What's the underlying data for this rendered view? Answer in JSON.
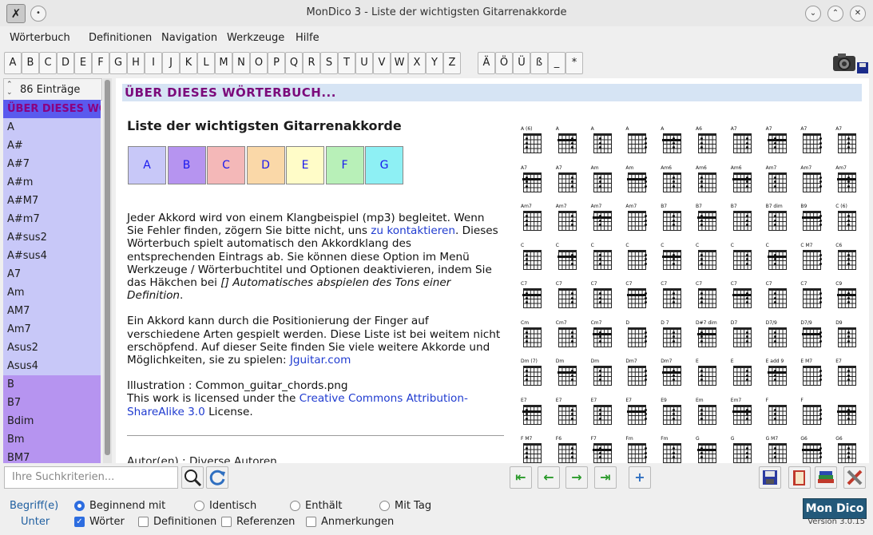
{
  "window": {
    "title": "MonDico 3 - Liste der wichtigsten Gitarrenakkorde"
  },
  "menu": [
    "Wörterbuch",
    "Definitionen",
    "Navigation",
    "Werkzeuge",
    "Hilfe"
  ],
  "letters": [
    "A",
    "B",
    "C",
    "D",
    "E",
    "F",
    "G",
    "H",
    "I",
    "J",
    "K",
    "L",
    "M",
    "N",
    "O",
    "P",
    "Q",
    "R",
    "S",
    "T",
    "U",
    "V",
    "W",
    "X",
    "Y",
    "Z",
    "Ä",
    "Ö",
    "Ü",
    "ß",
    "_",
    "*"
  ],
  "sidebar": {
    "count": "86 Einträge",
    "items": [
      "ÜBER DIESES WÖRTERBUCH...",
      "A",
      "A#",
      "A#7",
      "A#m",
      "A#M7",
      "A#m7",
      "A#sus2",
      "A#sus4",
      "A7",
      "Am",
      "AM7",
      "Am7",
      "Asus2",
      "Asus4",
      "B",
      "B7",
      "Bdim",
      "Bm",
      "BM7"
    ]
  },
  "content": {
    "header": "ÜBER DIESES WÖRTERBUCH...",
    "title": "Liste der wichtigsten Gitarrenakkorde",
    "keys": [
      {
        "label": "A",
        "color": "#c8c8f8"
      },
      {
        "label": "B",
        "color": "#b694f0"
      },
      {
        "label": "C",
        "color": "#f4b8b8"
      },
      {
        "label": "D",
        "color": "#fad8a8"
      },
      {
        "label": "E",
        "color": "#fffcc8"
      },
      {
        "label": "F",
        "color": "#b8f0b8"
      },
      {
        "label": "G",
        "color": "#8ef0f4"
      }
    ],
    "p1_a": "Jeder Akkord wird von einem Klangbeispiel (mp3) begleitet. Wenn Sie Fehler finden, zögern Sie bitte nicht, uns ",
    "p1_link": "zu kontaktieren",
    "p1_b": ". Dieses Wörterbuch spielt automatisch den Akkordklang des entsprechenden Eintrags ab. Sie können diese Option im Menü Werkzeuge / Wörterbuchtitel und Optionen deaktivieren, indem Sie das Häkchen bei ",
    "p1_em": "[] Automatisches abspielen des Tons einer Definition",
    "p1_c": ".",
    "p2_a": "Ein Akkord kann durch die Positionierung der Finger auf verschiedene Arten gespielt werden. Diese Liste ist bei weitem nicht erschöpfend. Auf dieser Seite finden Sie viele weitere Akkorde und Möglichkeiten, sie zu spielen: ",
    "p2_link": "Jguitar.com",
    "p3_line1": "Illustration : Common_guitar_chords.png",
    "p3_a": "This work is licensed under the ",
    "p3_link": "Creative Commons Attribution-ShareAlike 3.0",
    "p3_b": " License.",
    "author": "Autor(en) : Diverse Autoren",
    "chord_names": [
      "A (6)",
      "A",
      "A",
      "A",
      "A",
      "A6",
      "A7",
      "A7",
      "A7",
      "A7",
      "A7",
      "A7",
      "Am",
      "Am",
      "Am6",
      "Am6",
      "Am6",
      "Am7",
      "Am7",
      "Am7",
      "Am7",
      "Am7",
      "Am7",
      "Am7",
      "B7",
      "B7",
      "B7",
      "B7 dim",
      "B9",
      "C (6)",
      "C",
      "C",
      "C",
      "C",
      "C",
      "C",
      "C",
      "C",
      "C M7",
      "C6",
      "C7",
      "C7",
      "C7",
      "C7",
      "C7",
      "C7",
      "C7",
      "C7",
      "C7",
      "C9",
      "Cm",
      "Cm7",
      "Cm7",
      "D",
      "D 7",
      "D#7 dim",
      "D7",
      "D7/9",
      "D7/9",
      "D9",
      "Dm (7)",
      "Dm",
      "Dm",
      "Dm7",
      "Dm7",
      "E",
      "E",
      "E add 9",
      "E M7",
      "E7",
      "E7",
      "E7",
      "E7",
      "E7",
      "E9",
      "Em",
      "Em7",
      "F",
      "F",
      "",
      "F M7",
      "F6",
      "F7",
      "Fm",
      "Fm",
      "G",
      "G",
      "G M7",
      "G6",
      "G6"
    ]
  },
  "toolbar": {
    "search_placeholder": "Ihre Suchkriterien...",
    "search_icon": "magnifier-icon",
    "refresh_icon": "refresh-icon"
  },
  "options": {
    "term_label": "Begriff(e)",
    "sub_label": "Unter",
    "radios": [
      "Beginnend mit",
      "Identisch",
      "Enthält",
      "Mit Tag"
    ],
    "checks": [
      "Wörter",
      "Definitionen",
      "Referenzen",
      "Anmerkungen"
    ]
  },
  "brand": {
    "logo": "Mon Dico",
    "version": "Version 3.0.15"
  }
}
